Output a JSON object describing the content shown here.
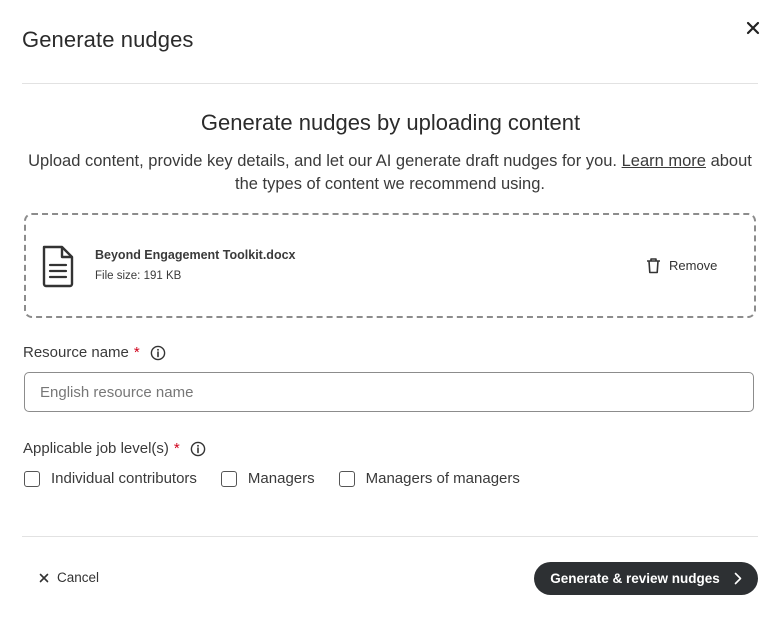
{
  "modal": {
    "title": "Generate nudges",
    "close_icon": "close-icon"
  },
  "intro": {
    "heading": "Generate nudges by uploading content",
    "text_before_link": "Upload content, provide key details, and let our AI generate draft nudges for you. ",
    "link_text": "Learn more",
    "text_after_link": " about the types of content we recommend using."
  },
  "upload": {
    "file_icon": "document-icon",
    "file_name": "Beyond Engagement Toolkit.docx",
    "file_size": "File size: 191 KB",
    "remove_icon": "trash-icon",
    "remove_label": "Remove"
  },
  "resource_name": {
    "label": "Resource name",
    "required_mark": "*",
    "info_icon": "info-icon",
    "value": "",
    "placeholder": "English resource name"
  },
  "job_levels": {
    "label": "Applicable job level(s)",
    "required_mark": "*",
    "info_icon": "info-icon",
    "options": [
      {
        "label": "Individual contributors",
        "checked": false
      },
      {
        "label": "Managers",
        "checked": false
      },
      {
        "label": "Managers of managers",
        "checked": false
      }
    ]
  },
  "footer": {
    "cancel_label": "Cancel",
    "cancel_icon": "close-icon",
    "primary_label": "Generate & review nudges",
    "primary_icon": "chevron-right-icon"
  },
  "colors": {
    "primary_button_bg": "#2d3033",
    "required": "#d0021b",
    "border": "#8c8c8c"
  }
}
